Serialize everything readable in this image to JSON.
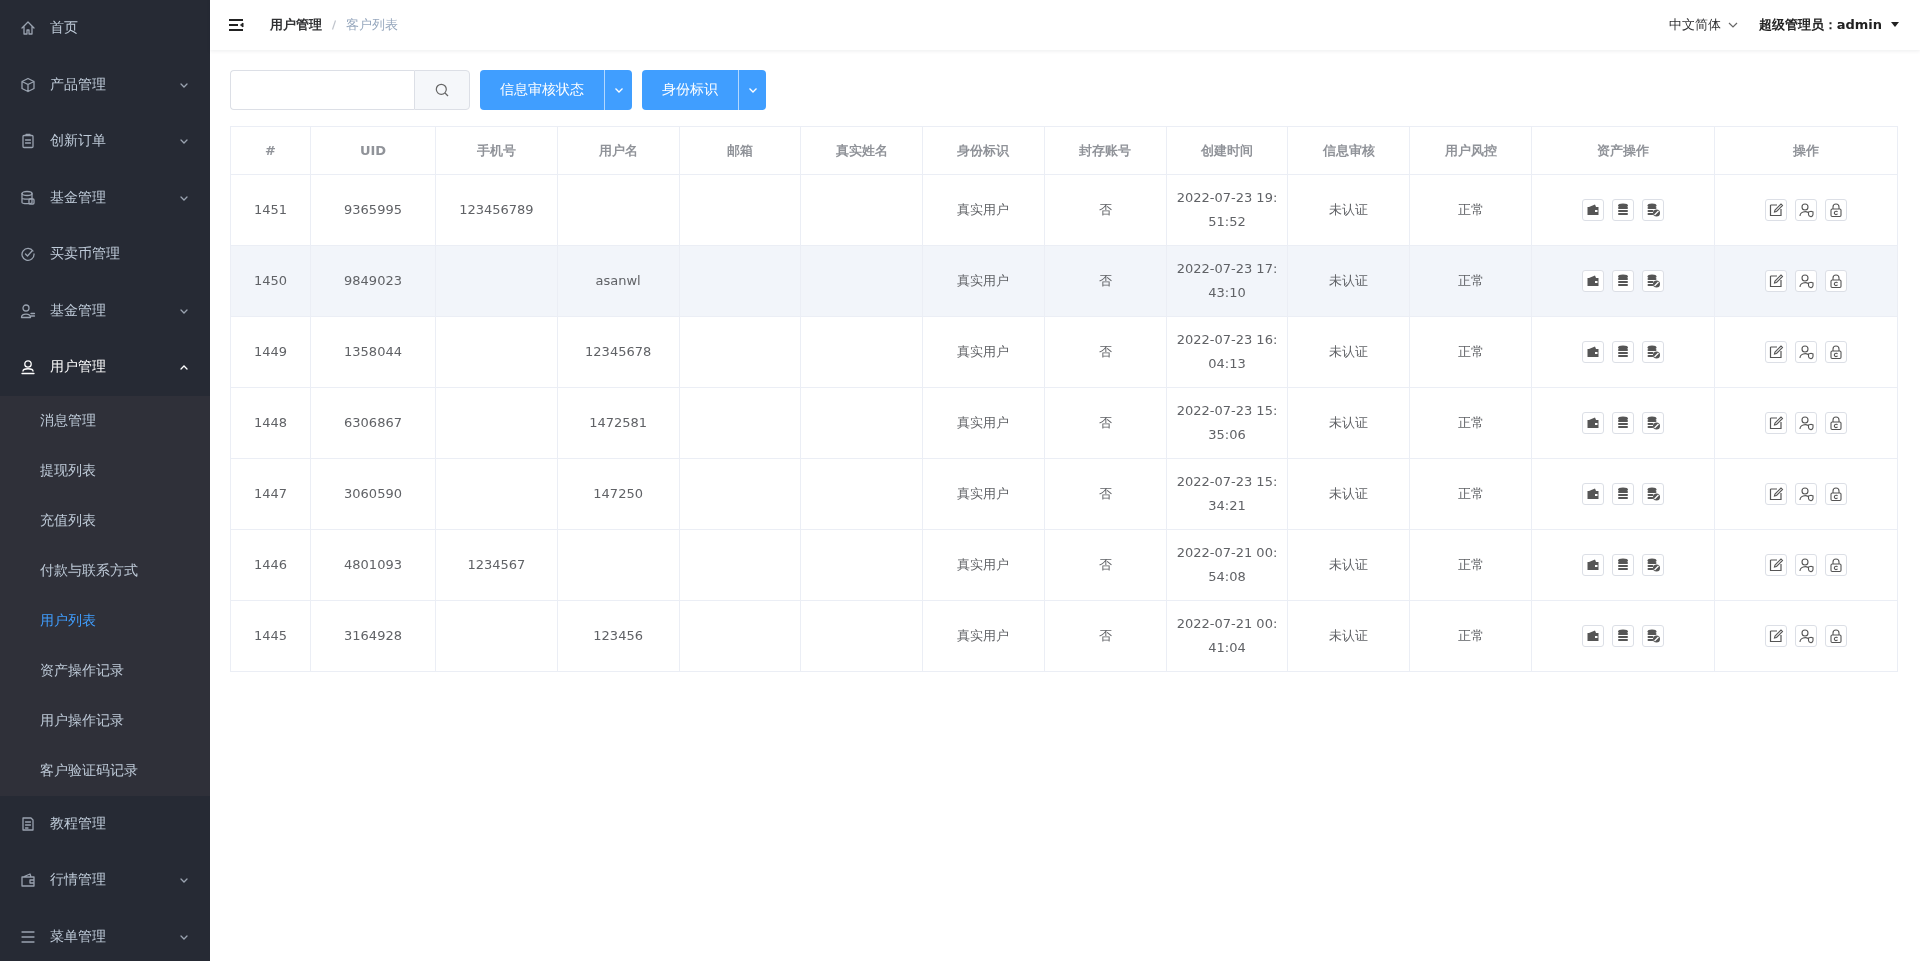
{
  "sidebar": {
    "items": [
      {
        "label": "首页"
      },
      {
        "label": "产品管理",
        "expanded": false
      },
      {
        "label": "创新订单",
        "expanded": false
      },
      {
        "label": "基金管理",
        "expanded": false
      },
      {
        "label": "买卖币管理"
      },
      {
        "label": "基金管理",
        "expanded": false
      },
      {
        "label": "用户管理",
        "expanded": true,
        "children": [
          {
            "label": "消息管理",
            "selected": false
          },
          {
            "label": "提现列表",
            "selected": false
          },
          {
            "label": "充值列表",
            "selected": false
          },
          {
            "label": "付款与联系方式",
            "selected": false
          },
          {
            "label": "用户列表",
            "selected": true
          },
          {
            "label": "资产操作记录",
            "selected": false
          },
          {
            "label": "用户操作记录",
            "selected": false
          },
          {
            "label": "客户验证码记录",
            "selected": false
          }
        ]
      },
      {
        "label": "教程管理"
      },
      {
        "label": "行情管理",
        "expanded": false
      },
      {
        "label": "菜单管理",
        "expanded": false
      }
    ]
  },
  "header": {
    "breadcrumb": [
      "用户管理",
      "客户列表"
    ],
    "language": "中文简体",
    "user": "超级管理员：admin"
  },
  "toolbar": {
    "dropdowns": [
      "信息审核状态",
      "身份标识"
    ]
  },
  "table": {
    "columns": [
      "#",
      "UID",
      "手机号",
      "用户名",
      "邮箱",
      "真实姓名",
      "身份标识",
      "封存账号",
      "创建时间",
      "信息审核",
      "用户风控",
      "资产操作",
      "操作"
    ],
    "rows": [
      {
        "highlighted": false,
        "cells": [
          "1451",
          "9365995",
          "123456789",
          "",
          "",
          "",
          "真实用户",
          "否",
          "2022-07-23 19:\n51:52",
          "未认证",
          "正常"
        ]
      },
      {
        "highlighted": true,
        "cells": [
          "1450",
          "9849023",
          "",
          "asanwl",
          "",
          "",
          "真实用户",
          "否",
          "2022-07-23 17:\n43:10",
          "未认证",
          "正常"
        ]
      },
      {
        "highlighted": false,
        "cells": [
          "1449",
          "1358044",
          "",
          "12345678",
          "",
          "",
          "真实用户",
          "否",
          "2022-07-23 16:\n04:13",
          "未认证",
          "正常"
        ]
      },
      {
        "highlighted": false,
        "cells": [
          "1448",
          "6306867",
          "",
          "1472581",
          "",
          "",
          "真实用户",
          "否",
          "2022-07-23 15:\n35:06",
          "未认证",
          "正常"
        ]
      },
      {
        "highlighted": false,
        "cells": [
          "1447",
          "3060590",
          "",
          "147250",
          "",
          "",
          "真实用户",
          "否",
          "2022-07-23 15:\n34:21",
          "未认证",
          "正常"
        ]
      },
      {
        "highlighted": false,
        "cells": [
          "1446",
          "4801093",
          "1234567",
          "",
          "",
          "",
          "真实用户",
          "否",
          "2022-07-21 00:\n54:08",
          "未认证",
          "正常"
        ]
      },
      {
        "highlighted": false,
        "cells": [
          "1445",
          "3164928",
          "",
          "123456",
          "",
          "",
          "真实用户",
          "否",
          "2022-07-21 00:\n41:04",
          "未认证",
          "正常"
        ]
      }
    ]
  }
}
